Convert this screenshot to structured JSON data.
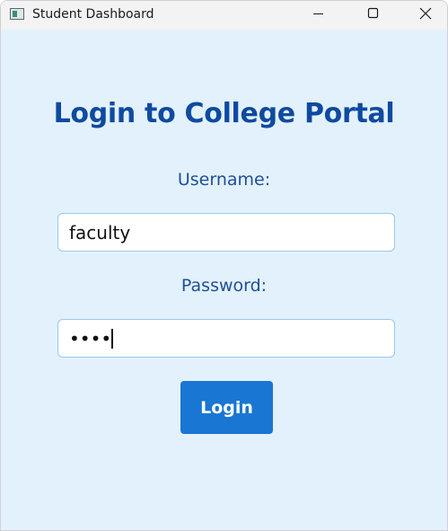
{
  "window": {
    "title": "Student Dashboard",
    "buttons": [
      "minimize",
      "maximize",
      "close"
    ]
  },
  "login": {
    "heading": "Login to College Portal",
    "username_label": "Username:",
    "username_value": "faculty",
    "password_label": "Password:",
    "password_value": "abcd",
    "submit_label": "Login"
  },
  "colors": {
    "background": "#e3f1fd",
    "heading": "#0f4aa0",
    "label": "#1f4f96",
    "input_border": "#9cc8e8",
    "button": "#1976d2",
    "button_text": "#ffffff",
    "titlebar": "#f3f3f3"
  },
  "icons": [
    "app-icon",
    "minimize-icon",
    "maximize-icon",
    "close-icon"
  ]
}
